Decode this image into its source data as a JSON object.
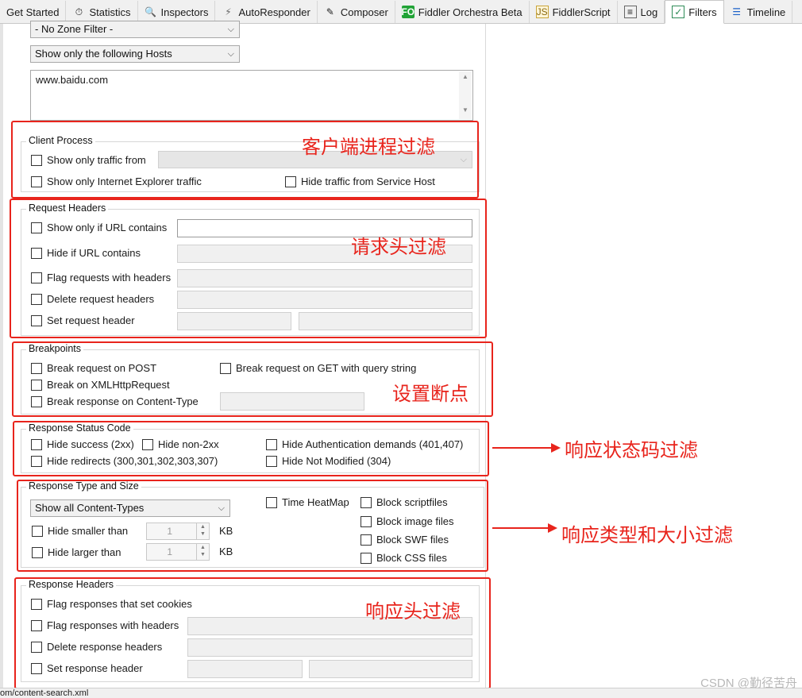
{
  "tabs": [
    {
      "label": "Get Started",
      "icon": ""
    },
    {
      "label": "Statistics",
      "icon": "stopwatch-icon"
    },
    {
      "label": "Inspectors",
      "icon": "magnifier-icon"
    },
    {
      "label": "AutoResponder",
      "icon": "lightning-icon"
    },
    {
      "label": "Composer",
      "icon": "pencil-icon"
    },
    {
      "label": "Fiddler Orchestra Beta",
      "icon": "fo-icon",
      "icon_text": "FO"
    },
    {
      "label": "FiddlerScript",
      "icon": "js-icon",
      "icon_text": "JS"
    },
    {
      "label": "Log",
      "icon": "log-icon"
    },
    {
      "label": "Filters",
      "icon": "checkbox-icon",
      "active": true
    },
    {
      "label": "Timeline",
      "icon": "timeline-icon"
    }
  ],
  "hosts": {
    "zone_filter": "- No Zone Filter -",
    "host_filter": "Show only the following Hosts",
    "host_list": "www.baidu.com"
  },
  "client_process": {
    "title": "Client Process",
    "show_only_from": "Show only traffic from",
    "ie_only": "Show only Internet Explorer traffic",
    "hide_service_host": "Hide traffic from Service Host"
  },
  "request_headers": {
    "title": "Request Headers",
    "show_if_url": "Show only if URL contains",
    "hide_if_url": "Hide if URL contains",
    "flag_requests": "Flag requests with headers",
    "delete_headers": "Delete request headers",
    "set_header": "Set request header"
  },
  "breakpoints": {
    "title": "Breakpoints",
    "on_post": "Break request on POST",
    "on_get_query": "Break request on GET with query string",
    "on_xhr": "Break on XMLHttpRequest",
    "on_content_type": "Break response on Content-Type"
  },
  "response_status": {
    "title": "Response Status Code",
    "hide_success": "Hide success (2xx)",
    "hide_non2xx": "Hide non-2xx",
    "hide_auth": "Hide Authentication demands (401,407)",
    "hide_redirects": "Hide redirects (300,301,302,303,307)",
    "hide_not_modified": "Hide Not Modified (304)"
  },
  "response_type": {
    "title": "Response Type and Size",
    "content_types": "Show all Content-Types",
    "time_heatmap": "Time HeatMap",
    "block_script": "Block scriptfiles",
    "block_image": "Block image files",
    "block_swf": "Block SWF files",
    "block_css": "Block CSS files",
    "hide_smaller": "Hide smaller than",
    "hide_larger": "Hide larger than",
    "smaller_value": "1",
    "larger_value": "1",
    "unit": "KB"
  },
  "response_headers": {
    "title": "Response Headers",
    "flag_cookies": "Flag responses that set cookies",
    "flag_headers": "Flag responses with headers",
    "delete_headers": "Delete response headers",
    "set_header": "Set response header"
  },
  "annotations": {
    "client_process": "客户端进程过滤",
    "request_headers": "请求头过滤",
    "breakpoints": "设置断点",
    "response_status": "响应状态码过滤",
    "response_type": "响应类型和大小过滤",
    "response_headers": "响应头过滤",
    "color": "#e8241c"
  },
  "status_bar": "om/content-search.xml",
  "watermark": "CSDN @勤径苦舟"
}
